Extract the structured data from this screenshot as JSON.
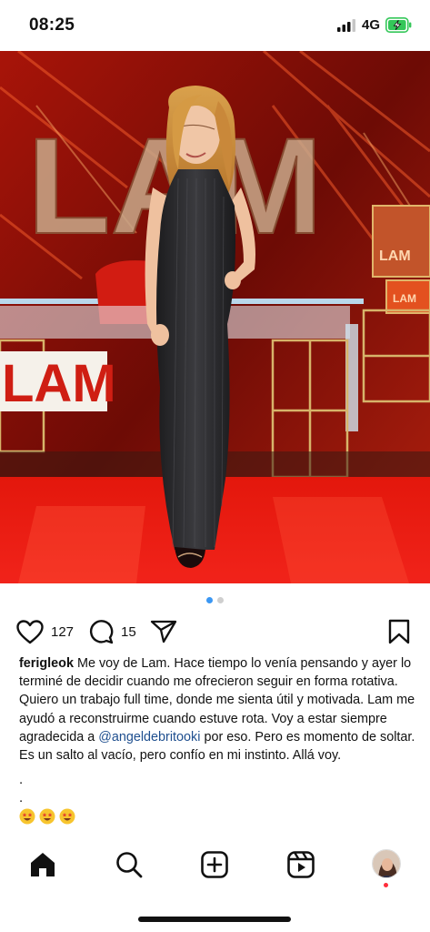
{
  "status_bar": {
    "time": "08:25",
    "network": "4G",
    "icons": [
      "signal-icon",
      "battery-charging-icon"
    ]
  },
  "post": {
    "carousel": {
      "total_slides": 2,
      "active_slide": 1
    },
    "brand_text": "LAM",
    "monitor_text": "LAM",
    "likes": "127",
    "comments": "15",
    "caption": {
      "username": "ferigleok",
      "text_before_mention": "Me voy de Lam. Hace tiempo lo venía pensando y ayer lo terminé de decidir cuando me ofrecieron seguir en forma rotativa. Quiero un trabajo full time, donde me sienta útil y motivada. Lam me ayudó a reconstruirme cuando estuve rota. Voy a estar siempre agradecida a",
      "mention": "@angeldebritooki",
      "text_after_mention": "por eso. Pero es momento de soltar. Es un salto al vacío, pero confío en mi instinto. Allá voy.",
      "dot1": ".",
      "dot2": ".",
      "emoji_count": 3
    }
  },
  "nav": {
    "items": [
      "home-icon",
      "search-icon",
      "create-icon",
      "reels-icon",
      "profile-avatar"
    ]
  },
  "colors": {
    "accent_blue": "#3b97f3",
    "mention": "#1f4f8f",
    "set_red": "#d81b10",
    "battery_green": "#34c759",
    "notification_red": "#ff2d3b"
  }
}
